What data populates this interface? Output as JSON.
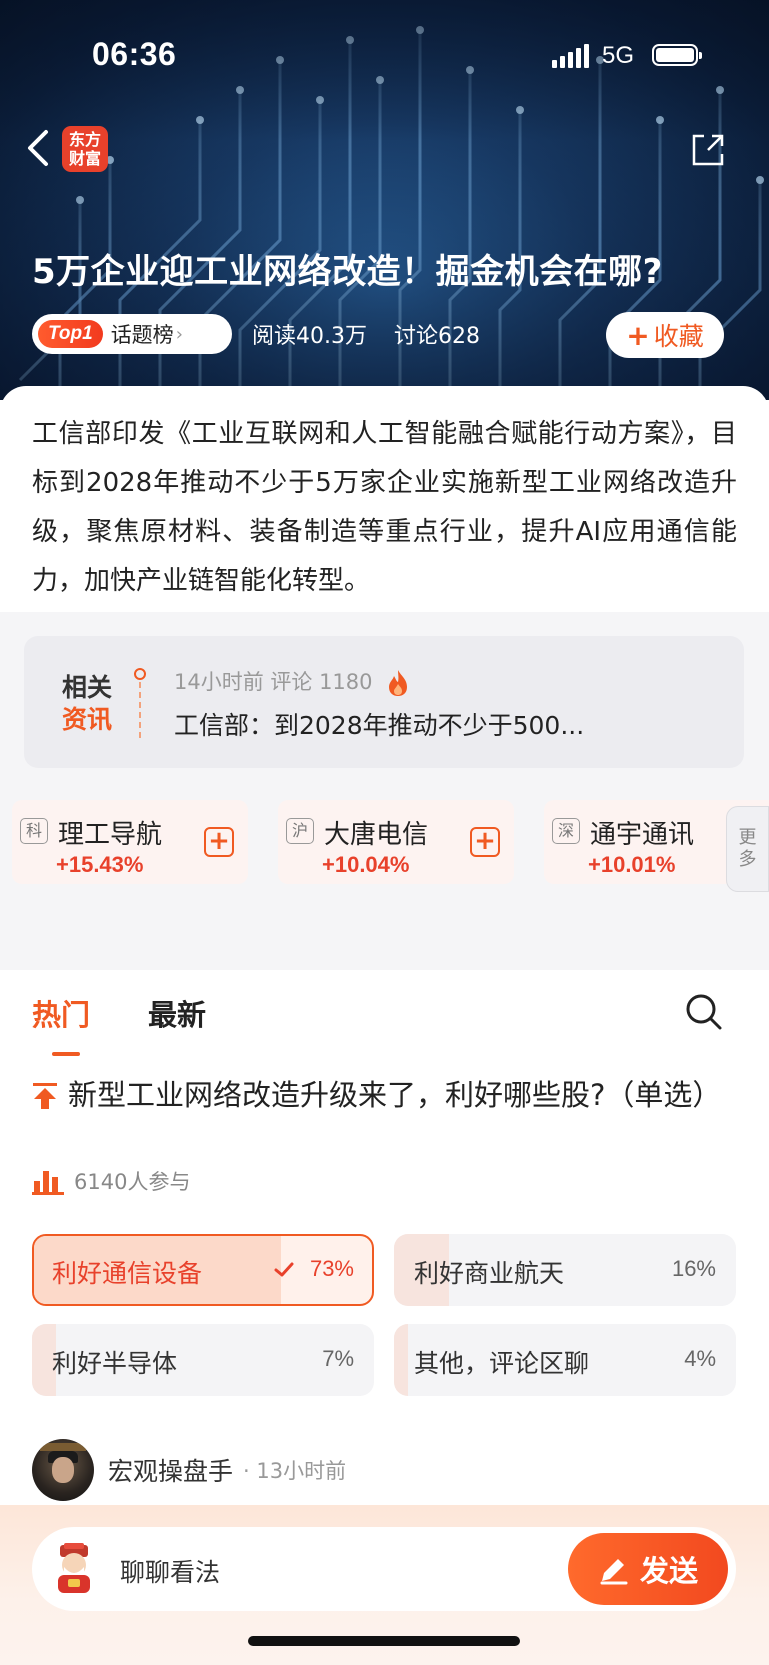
{
  "status_bar": {
    "time": "06:36",
    "network": "5G"
  },
  "header": {
    "logo_line1": "东方",
    "logo_line2": "财富",
    "headline": "5万企业迎工业网络改造！掘金机会在哪?",
    "topic_badge": "Top1",
    "topic_label": "话题榜",
    "reads": "阅读40.3万",
    "discussions": "讨论628",
    "collect_label": "收藏"
  },
  "summary": "工信部印发《工业互联网和人工智能融合赋能行动方案》，目标到2028年推动不少于5万家企业实施新型工业网络改造升级，聚焦原材料、装备制造等重点行业，提升AI应用通信能力，加快产业链智能化转型。",
  "related": {
    "label_line1": "相关",
    "label_line2": "资讯",
    "meta": "14小时前  评论 1180",
    "title": "工信部：到2028年推动不少于500..."
  },
  "stocks": [
    {
      "market": "科",
      "name": "理工导航",
      "change": "+15.43%"
    },
    {
      "market": "沪",
      "name": "大唐电信",
      "change": "+10.04%"
    },
    {
      "market": "深",
      "name": "通宇通讯",
      "change": "+10.01%"
    }
  ],
  "more_label_1": "更",
  "more_label_2": "多",
  "tabs": {
    "hot": "热门",
    "latest": "最新"
  },
  "poll": {
    "question": "新型工业网络改造升级来了，利好哪些股?（单选）",
    "participants": "6140人参与",
    "options": [
      {
        "label": "利好通信设备",
        "percent": "73%",
        "value": 0.73,
        "selected": true
      },
      {
        "label": "利好商业航天",
        "percent": "16%",
        "value": 0.16,
        "selected": false
      },
      {
        "label": "利好半导体",
        "percent": "7%",
        "value": 0.07,
        "selected": false
      },
      {
        "label": "其他，评论区聊",
        "percent": "4%",
        "value": 0.04,
        "selected": false
      }
    ]
  },
  "post": {
    "author": "宏观操盘手",
    "time": "· 13小时前"
  },
  "composer": {
    "placeholder": "聊聊看法",
    "send_label": "发送"
  },
  "colors": {
    "accent": "#f05a22",
    "rise": "#e8412b"
  }
}
